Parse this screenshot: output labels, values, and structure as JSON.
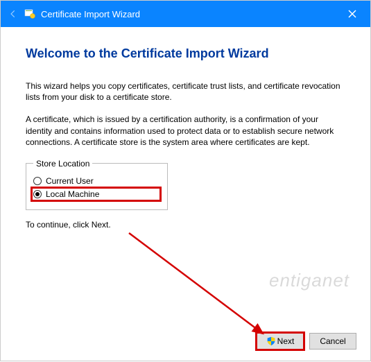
{
  "titlebar": {
    "title": "Certificate Import Wizard"
  },
  "heading": "Welcome to the Certificate Import Wizard",
  "para1": "This wizard helps you copy certificates, certificate trust lists, and certificate revocation lists from your disk to a certificate store.",
  "para2": "A certificate, which is issued by a certification authority, is a confirmation of your identity and contains information used to protect data or to establish secure network connections. A certificate store is the system area where certificates are kept.",
  "store": {
    "legend": "Store Location",
    "option1": "Current User",
    "option2": "Local Machine",
    "selected": "Local Machine"
  },
  "continue_text": "To continue, click Next.",
  "buttons": {
    "next": "Next",
    "cancel": "Cancel"
  },
  "watermark": "entiganet"
}
